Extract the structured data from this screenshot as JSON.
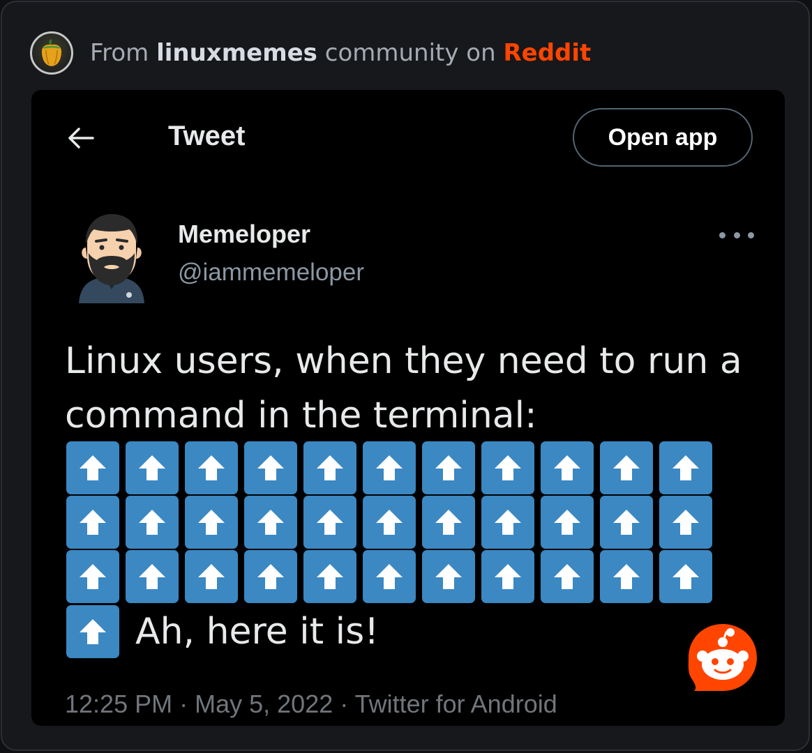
{
  "source": {
    "prefix": "From",
    "community": "linuxmemes",
    "middle": "community on",
    "platform": "Reddit",
    "avatar_icon": "bell-pepper-icon"
  },
  "tweet_header": {
    "back_icon": "arrow-left-icon",
    "title": "Tweet",
    "open_app_label": "Open app"
  },
  "author": {
    "name": "Memeloper",
    "handle": "@iammemeloper",
    "avatar_icon": "bearded-man-avatar",
    "more_icon": "more-horizontal-icon"
  },
  "tweet": {
    "text": "Linux users, when they need to run a command in the terminal:",
    "emoji_icon": "up-arrow-key-emoji",
    "emoji_rows": [
      11,
      11,
      11
    ],
    "after_emoji_count": 1,
    "after_text": "Ah, here it is!"
  },
  "meta": {
    "time": "12:25 PM",
    "separator": "·",
    "date": "May 5, 2022",
    "client": "Twitter for Android"
  },
  "colors": {
    "reddit_orange": "#ff4500",
    "emoji_blue": "#3b88c3"
  },
  "badge": {
    "icon": "reddit-snoo-icon"
  }
}
